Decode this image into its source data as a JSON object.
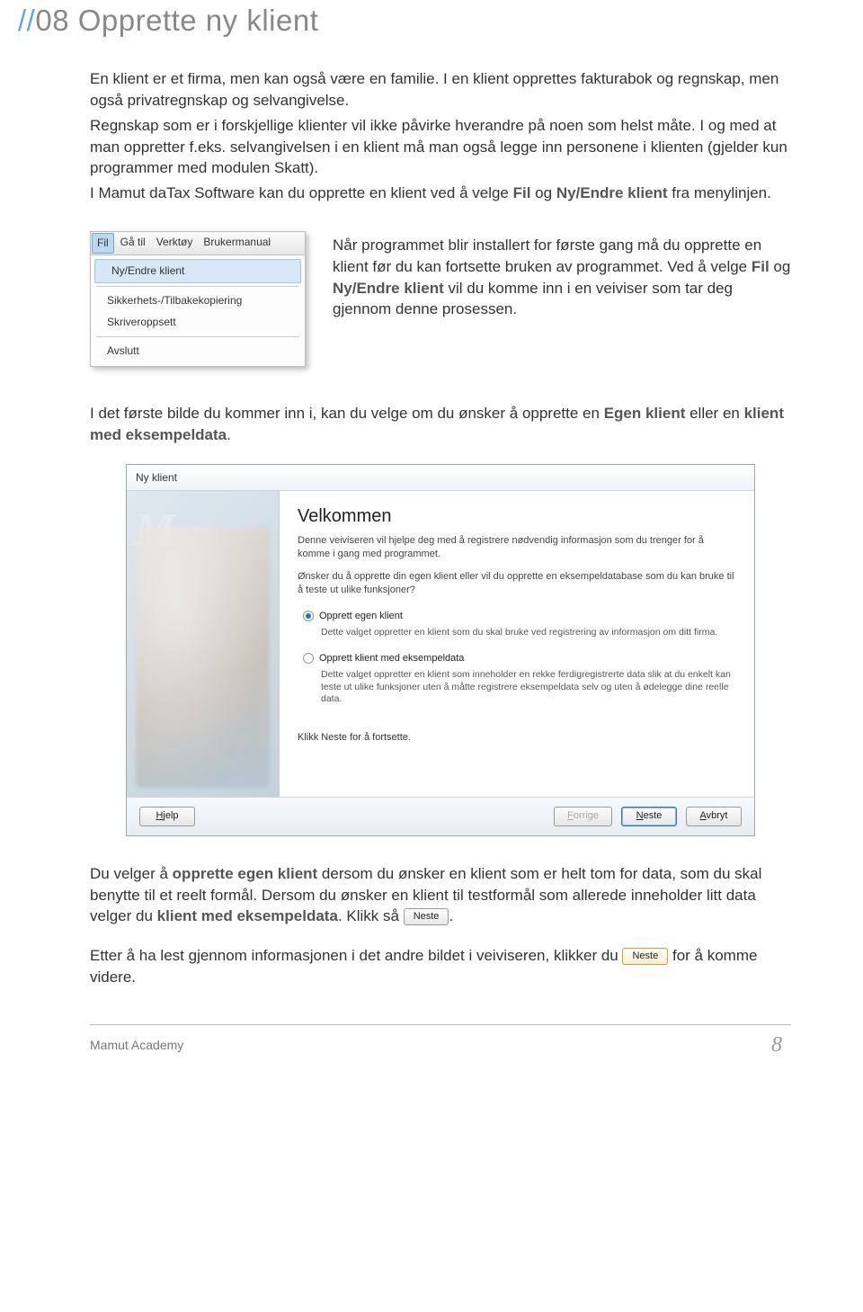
{
  "heading": {
    "slashes": "//",
    "num": "08",
    "title": "Opprette ny klient"
  },
  "intro": {
    "p1": "En klient er et firma, men kan også være en familie. I en klient opprettes fakturabok og regnskap, men også privatregnskap og selvangivelse.",
    "p2": "Regnskap som er i forskjellige klienter vil ikke påvirke hverandre på noen som helst måte. I og med at man oppretter f.eks. selvangivelsen i en klient må man også legge inn personene i klienten (gjelder kun programmer med modulen Skatt).",
    "p3_a": "I Mamut daTax Software kan du opprette en klient ved å velge ",
    "p3_b": "Fil",
    "p3_c": " og ",
    "p3_d": "Ny/Endre klient",
    "p3_e": " fra menylinjen."
  },
  "menu": {
    "bar": [
      "Fil",
      "Gå til",
      "Verktøy",
      "Brukermanual"
    ],
    "items": {
      "ny_endre": "Ny/Endre klient",
      "sikkerhet": "Sikkerhets-/Tilbakekopiering",
      "skriver": "Skriveroppsett",
      "avslutt": "Avslutt"
    }
  },
  "beside": {
    "p_a": "Når programmet blir installert for første gang må du opprette en klient før du kan fortsette bruken av programmet. Ved å velge ",
    "p_b": "Fil",
    "p_c": " og ",
    "p_d": "Ny/Endre klient",
    "p_e": " vil du komme inn i en veiviser som tar deg gjennom denne prosessen."
  },
  "mid": {
    "p_a": "I det første bilde du kommer inn i, kan du velge om du ønsker å opprette en ",
    "p_b": "Egen klient",
    "p_c": " eller en ",
    "p_d": "klient med eksempeldata",
    "p_e": "."
  },
  "wizard": {
    "title": "Ny klient",
    "heading": "Velkommen",
    "p1": "Denne veiviseren vil hjelpe deg med å registrere nødvendig informasjon som du trenger for å komme i gang med programmet.",
    "p2": "Ønsker du å opprette din egen klient eller vil du opprette en eksempeldatabase som du kan bruke til å teste ut ulike funksjoner?",
    "opt1": {
      "label": "Opprett egen klient",
      "desc": "Dette valget oppretter en klient som du skal bruke ved registrering av informasjon om ditt firma."
    },
    "opt2": {
      "label": "Opprett klient med eksempeldata",
      "desc": "Dette valget oppretter en klient som inneholder en rekke ferdigregistrerte data slik at du enkelt kan teste ut ulike funksjoner uten å måtte registrere eksempeldata selv og uten å ødelegge dine reelle data."
    },
    "footer_note": "Klikk Neste for å fortsette.",
    "buttons": {
      "help": "Hjelp",
      "back": "Forrige",
      "next": "Neste",
      "cancel": "Avbryt"
    },
    "watermark": "M"
  },
  "after": {
    "p1_a": "Du velger å ",
    "p1_b": "opprette egen klient",
    "p1_c": " dersom du ønsker en klient som er helt tom for data, som du skal benytte til et reelt formål. Dersom du ønsker en klient til testformål som allerede inneholder litt data velger du ",
    "p1_d": "klient med eksempeldata",
    "p1_e": ". Klikk så ",
    "btn1": "Neste",
    "p1_f": ".",
    "p2_a": "Etter å ha lest gjennom informasjonen i det andre bildet i veiviseren, klikker du ",
    "btn2": "Neste",
    "p2_b": " for å komme videre."
  },
  "footer": {
    "brand": "Mamut Academy",
    "page": "8"
  }
}
